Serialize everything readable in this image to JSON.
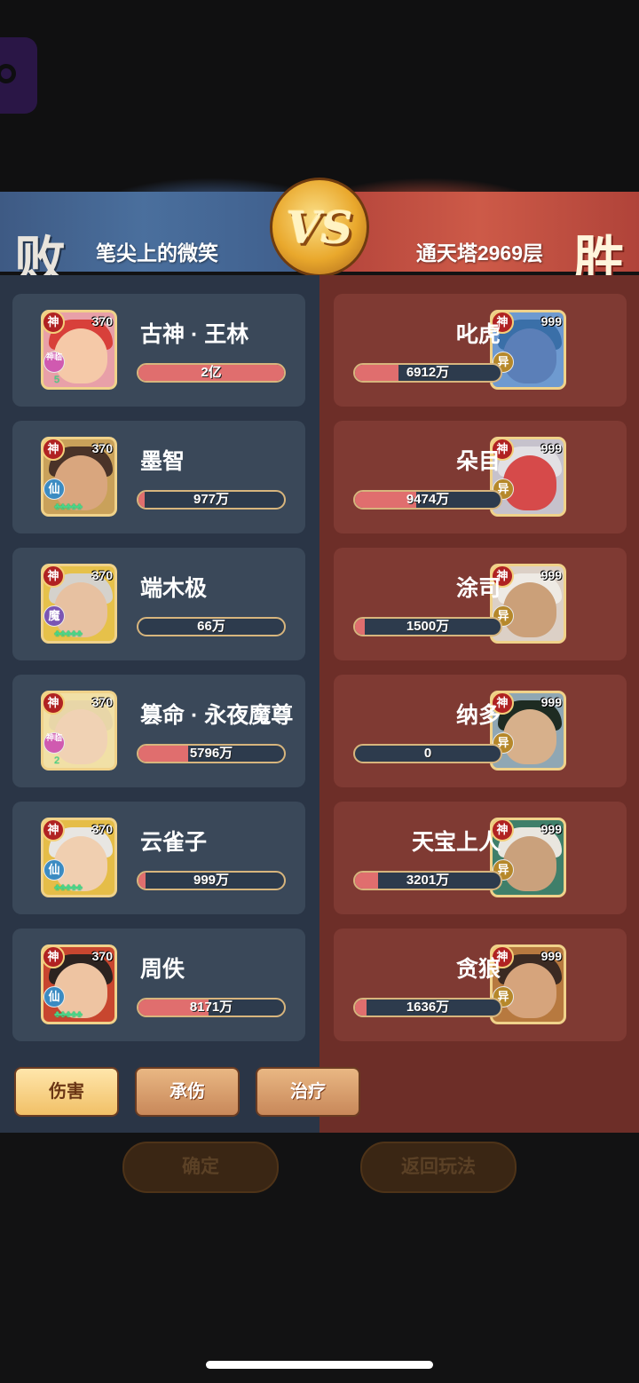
{
  "header": {
    "left_result": "败",
    "right_result": "胜",
    "left_player": "笔尖上的微笑",
    "right_player": "通天塔2969层",
    "vs_label": "VS"
  },
  "left_team": [
    {
      "name": "古神 · 王林",
      "god": "神",
      "level": "370",
      "type": "神临",
      "value": "2亿",
      "fill": 1.0,
      "stars": "5",
      "colors": {
        "hair": "#d8403a",
        "face": "#f5c9a8",
        "bg": "#e8a0a8"
      }
    },
    {
      "name": "墨智",
      "god": "神",
      "level": "370",
      "type": "仙",
      "value": "977万",
      "fill": 0.04,
      "stars": "♣♣♣♣♣",
      "colors": {
        "hair": "#4a3328",
        "face": "#d9a67e",
        "bg": "#c9a15a"
      }
    },
    {
      "name": "端木极",
      "god": "神",
      "level": "370",
      "type": "魔",
      "value": "66万",
      "fill": 0.0,
      "stars": "♣♣♣♣♣",
      "colors": {
        "hair": "#d5d2cc",
        "face": "#e7c1a1",
        "bg": "#e6c14a"
      }
    },
    {
      "name": "篡命 · 永夜魔尊",
      "god": "神",
      "level": "370",
      "type": "神临",
      "value": "5796万",
      "fill": 0.34,
      "stars": "2",
      "colors": {
        "hair": "#e8d6a8",
        "face": "#f0d2b4",
        "bg": "#f1e0a6"
      }
    },
    {
      "name": "云雀子",
      "god": "神",
      "level": "370",
      "type": "仙",
      "value": "999万",
      "fill": 0.05,
      "stars": "♣♣♣♣♣",
      "colors": {
        "hair": "#e8e6e2",
        "face": "#f0cfb0",
        "bg": "#e5bd48"
      }
    },
    {
      "name": "周佚",
      "god": "神",
      "level": "370",
      "type": "仙",
      "value": "8171万",
      "fill": 0.48,
      "stars": "♣♣♣♣♣",
      "colors": {
        "hair": "#2c2320",
        "face": "#eec4a2",
        "bg": "#c8462f"
      }
    }
  ],
  "right_team": [
    {
      "name": "叱虎",
      "god": "神",
      "level": "999",
      "type": "异",
      "value": "6912万",
      "fill": 0.3,
      "colors": {
        "hair": "#3a6fa8",
        "face": "#5b7fb8",
        "bg": "#6e9ad0"
      }
    },
    {
      "name": "朵目",
      "god": "神",
      "level": "999",
      "type": "异",
      "value": "9474万",
      "fill": 0.42,
      "colors": {
        "hair": "#e2e0e4",
        "face": "#d64a4a",
        "bg": "#c6c2cc"
      }
    },
    {
      "name": "涂司",
      "god": "神",
      "level": "999",
      "type": "异",
      "value": "1500万",
      "fill": 0.07,
      "colors": {
        "hair": "#eeeae4",
        "face": "#cba079",
        "bg": "#dcd0c6"
      }
    },
    {
      "name": "纳多",
      "god": "神",
      "level": "999",
      "type": "异",
      "value": "0",
      "fill": 0.0,
      "colors": {
        "hair": "#1e2b22",
        "face": "#d7b08b",
        "bg": "#8fa7b4"
      }
    },
    {
      "name": "天宝上人",
      "god": "神",
      "level": "999",
      "type": "异",
      "value": "3201万",
      "fill": 0.16,
      "colors": {
        "hair": "#e9e6df",
        "face": "#caa17c",
        "bg": "#3f7f6a"
      }
    },
    {
      "name": "贪狼",
      "god": "神",
      "level": "999",
      "type": "异",
      "value": "1636万",
      "fill": 0.08,
      "colors": {
        "hair": "#3b2a22",
        "face": "#d6a47c",
        "bg": "#b7793f"
      }
    }
  ],
  "tabs": [
    "伤害",
    "承伤",
    "治疗"
  ],
  "active_tab": 0,
  "buttons": {
    "confirm": "确定",
    "back": "返回玩法"
  }
}
